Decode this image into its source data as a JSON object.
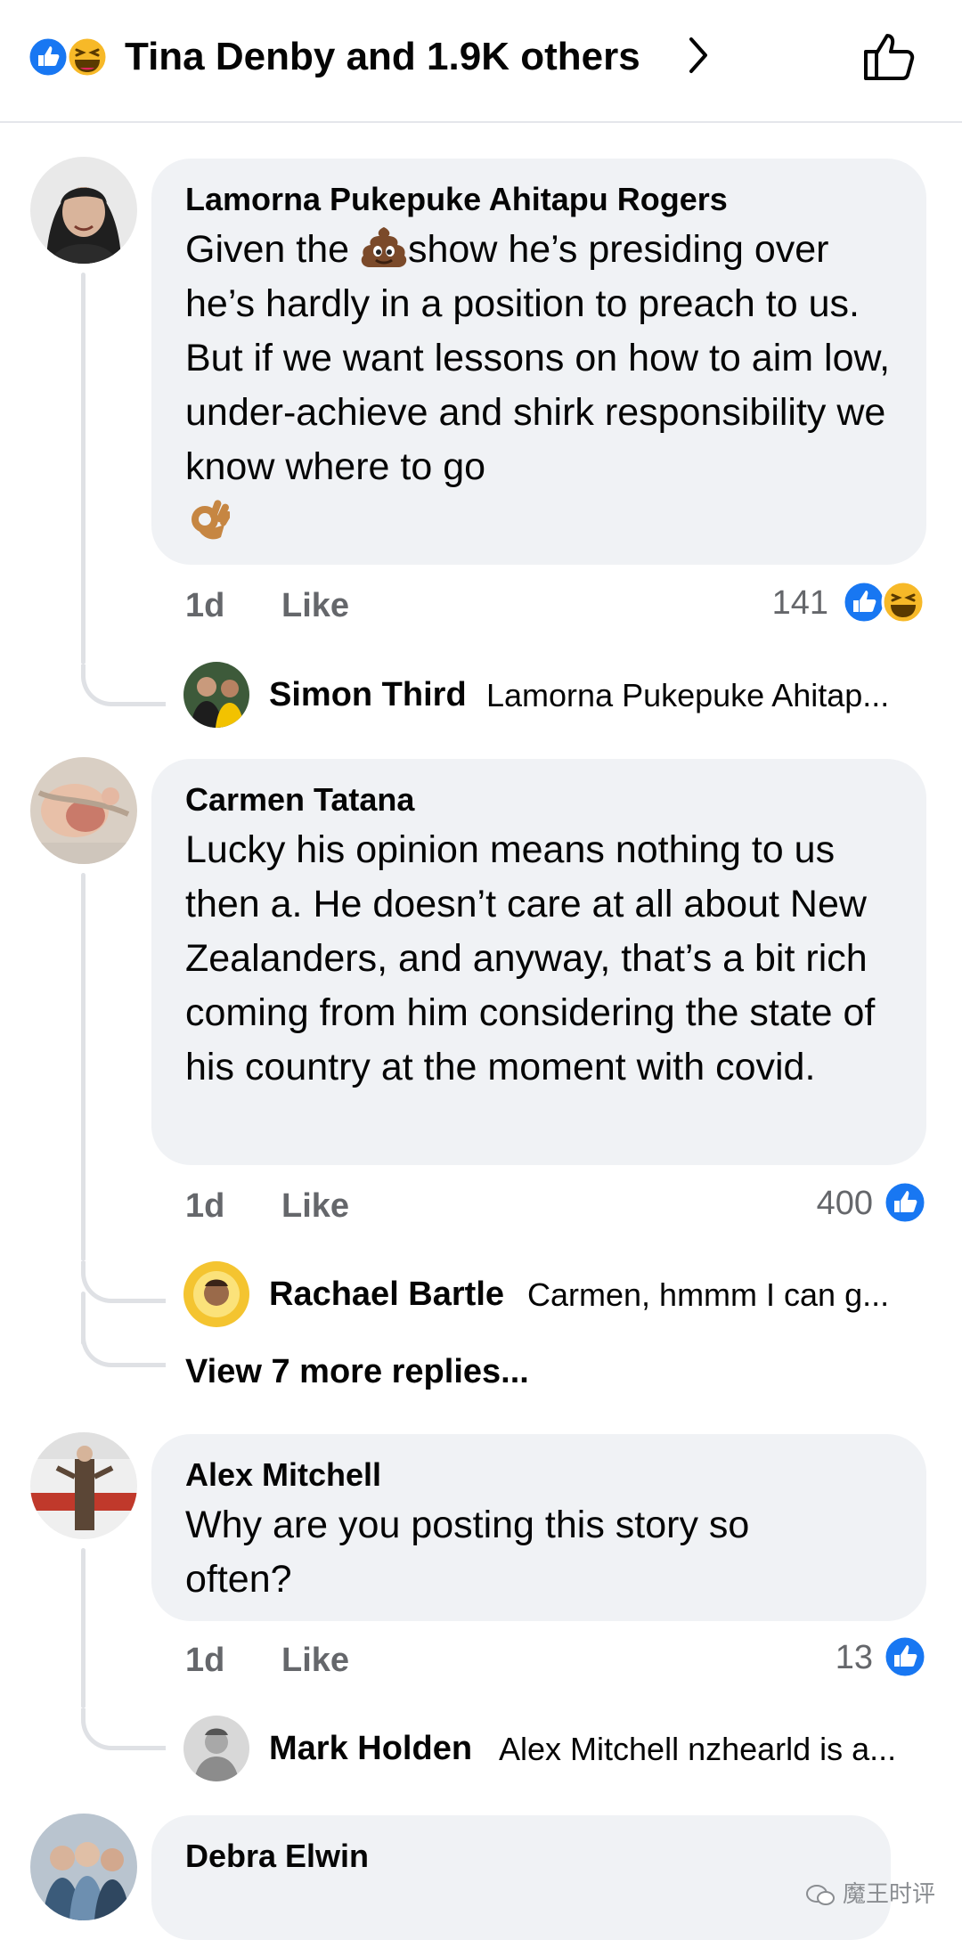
{
  "header": {
    "title": "Tina Denby and 1.9K others",
    "reaction_icons": [
      "like-icon",
      "haha-icon"
    ],
    "chevron_icon": "chevron-right-icon",
    "like_button_icon": "thumbs-up-outline-icon"
  },
  "comments": [
    {
      "author": "Lamorna Pukepuke Ahitapu Rogers",
      "text_before_emoji": "Given the ",
      "inline_emoji": "poop-emoji",
      "text_after_emoji": "show he’s presiding over he’s hardly in a position to preach to us. But if we want lessons on how to aim low, under-achieve and shirk responsibility we know where to go",
      "trailing_emoji": "ok-hand-emoji",
      "time": "1d",
      "like_label": "Like",
      "reaction_count": "141",
      "reaction_icons": [
        "like-icon",
        "haha-icon"
      ],
      "reply": {
        "name": "Simon Third",
        "text": "Lamorna Pukepuke Ahitap..."
      }
    },
    {
      "author": "Carmen Tatana",
      "text": "Lucky his opinion means nothing to us then a. He doesn’t care at all about New Zealanders, and anyway, that’s a bit rich coming from him considering the state of his country at the moment with covid.",
      "time": "1d",
      "like_label": "Like",
      "reaction_count": "400",
      "reaction_icons": [
        "like-icon"
      ],
      "reply": {
        "name": "Rachael Bartle",
        "text": "Carmen, hmmm I can g..."
      },
      "view_more": "View 7 more replies..."
    },
    {
      "author": "Alex Mitchell",
      "text": "Why are you posting this story so often?",
      "time": "1d",
      "like_label": "Like",
      "reaction_count": "13",
      "reaction_icons": [
        "like-icon"
      ],
      "reply": {
        "name": "Mark Holden",
        "text": "Alex Mitchell nzhearld is a..."
      }
    },
    {
      "author": "Debra Elwin"
    }
  ],
  "watermark": "魔王时评",
  "colors": {
    "like_blue": "#1877f2",
    "haha_yellow": "#f7b928",
    "bubble_bg": "#f0f2f5",
    "meta_gray": "#65676b"
  }
}
